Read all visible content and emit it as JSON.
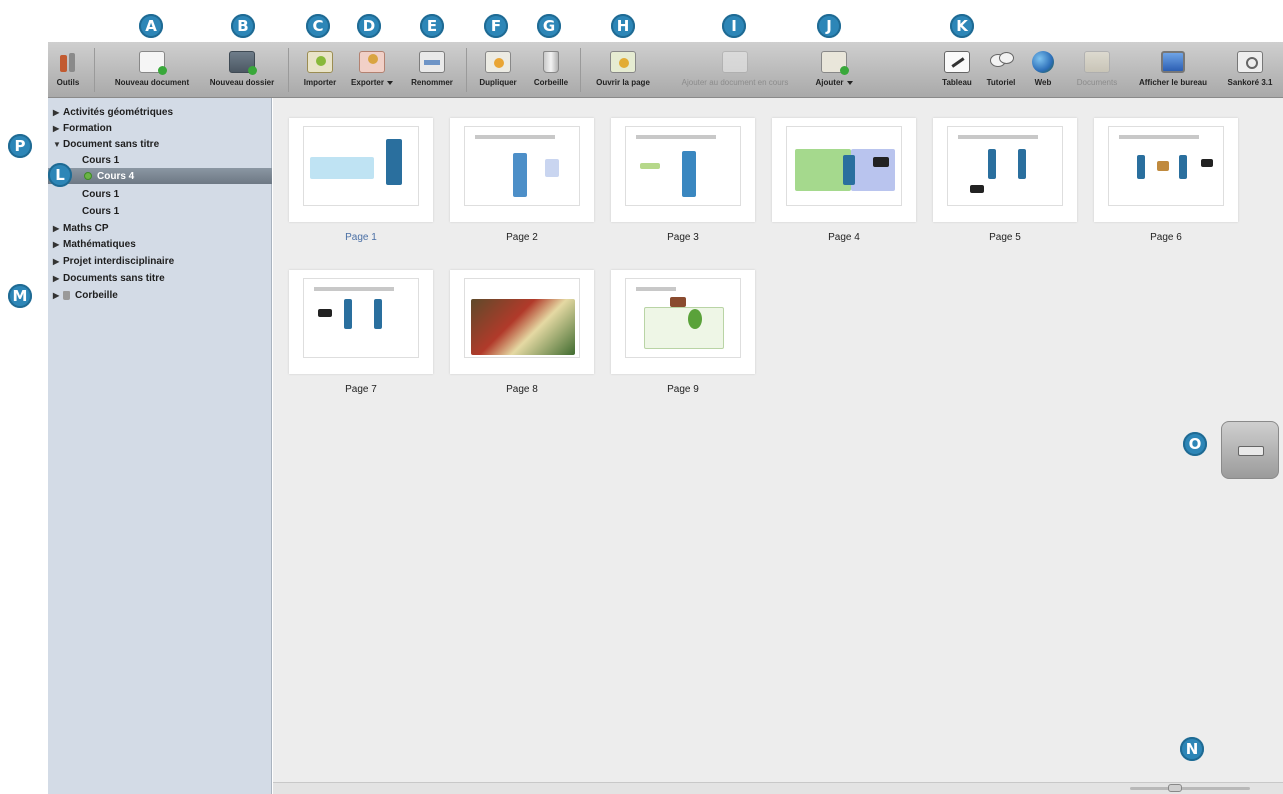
{
  "toolbar": {
    "items": [
      {
        "label": "Outils",
        "icon": "tools-icon"
      },
      {
        "label": "Nouveau document",
        "icon": "new-document-icon"
      },
      {
        "label": "Nouveau dossier",
        "icon": "new-folder-icon"
      },
      {
        "label": "Importer",
        "icon": "import-icon"
      },
      {
        "label": "Exporter",
        "icon": "export-icon"
      },
      {
        "label": "Renommer",
        "icon": "rename-icon"
      },
      {
        "label": "Dupliquer",
        "icon": "duplicate-icon"
      },
      {
        "label": "Corbeille",
        "icon": "trash-icon"
      },
      {
        "label": "Ouvrir la page",
        "icon": "open-page-icon"
      },
      {
        "label": "Ajouter au document en cours",
        "icon": "add-to-current-icon"
      },
      {
        "label": "Ajouter",
        "icon": "add-icon"
      },
      {
        "label": "Tableau",
        "icon": "board-icon"
      },
      {
        "label": "Tutoriel",
        "icon": "tutorial-icon"
      },
      {
        "label": "Web",
        "icon": "web-icon"
      },
      {
        "label": "Documents",
        "icon": "documents-icon"
      },
      {
        "label": "Afficher le bureau",
        "icon": "desktop-icon"
      },
      {
        "label": "Sankoré 3.1",
        "icon": "sankore-icon"
      }
    ]
  },
  "callouts": [
    "A",
    "B",
    "C",
    "D",
    "E",
    "F",
    "G",
    "H",
    "I",
    "J",
    "K",
    "L",
    "M",
    "N",
    "O",
    "P"
  ],
  "sidebar": {
    "items": [
      {
        "label": "Activités géométriques",
        "level": 0,
        "expanded": false
      },
      {
        "label": "Formation",
        "level": 0,
        "expanded": false
      },
      {
        "label": "Document sans titre",
        "level": 0,
        "expanded": true
      },
      {
        "label": "Cours 1",
        "level": 1
      },
      {
        "label": "Cours 4",
        "level": 1,
        "selected": true
      },
      {
        "label": "Cours 1",
        "level": 1
      },
      {
        "label": "Cours 1",
        "level": 1
      },
      {
        "label": "Maths CP",
        "level": 0,
        "expanded": false
      },
      {
        "label": "Mathématiques",
        "level": 0,
        "expanded": false
      },
      {
        "label": "Projet interdisciplinaire",
        "level": 0,
        "expanded": false
      },
      {
        "label": "Documents sans titre",
        "level": 0,
        "expanded": false
      },
      {
        "label": "Corbeille",
        "level": 0,
        "expanded": false
      }
    ]
  },
  "pages": [
    {
      "label": "Page 1"
    },
    {
      "label": "Page 2"
    },
    {
      "label": "Page 3"
    },
    {
      "label": "Page 4"
    },
    {
      "label": "Page 5"
    },
    {
      "label": "Page 6"
    },
    {
      "label": "Page 7"
    },
    {
      "label": "Page 8"
    },
    {
      "label": "Page 9"
    }
  ],
  "colors": {
    "toolbar": "#bdbdbd",
    "sidebar": "#d3dbe6",
    "content": "#ededed",
    "callout": "#2d86b7",
    "selected_row": "#7b8692"
  }
}
